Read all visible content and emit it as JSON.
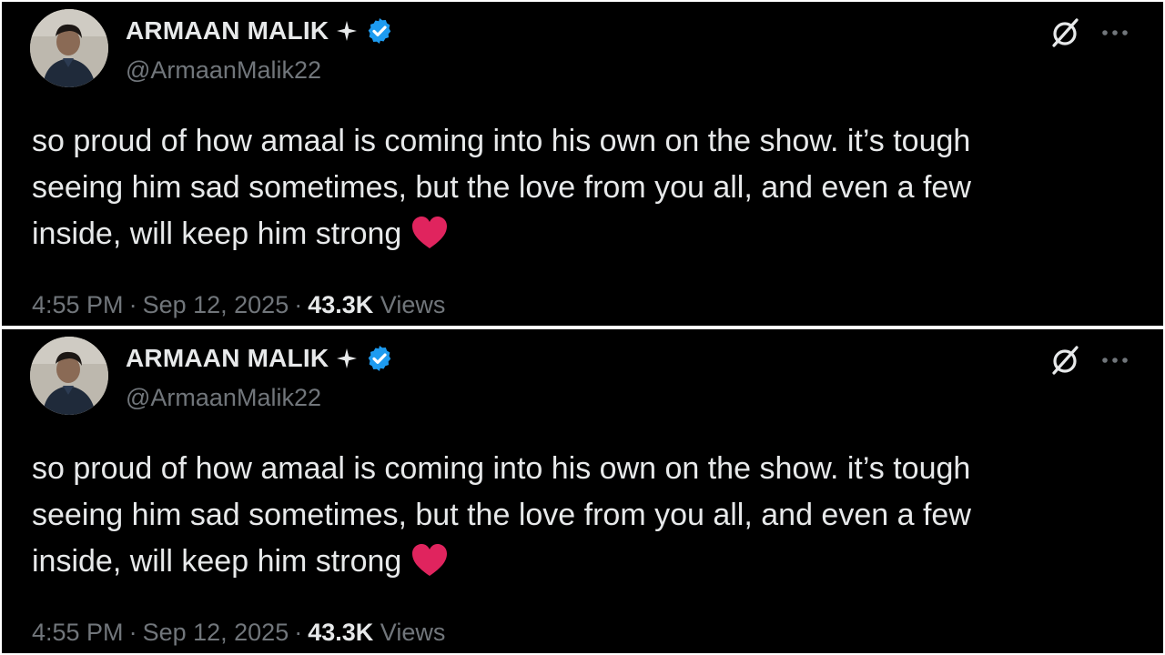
{
  "tweets": [
    {
      "author": {
        "display_name": "ARMAAN MALIK",
        "handle": "@ArmaanMalik22",
        "avatar_icon": "avatar-photo",
        "badges": [
          "sparkle-icon",
          "verified-icon"
        ],
        "verified_color": "#1d9bf0"
      },
      "text": {
        "line1": "so proud of how amaal is coming into his own on the show. it’s tough",
        "line2": "seeing him sad sometimes, but the love from you all, and even a few",
        "line3": "inside, will keep him strong",
        "emoji": "red-heart"
      },
      "meta": {
        "time": "4:55 PM",
        "separator": "·",
        "date": "Sep 12, 2025",
        "views_count": "43.3K",
        "views_label": "Views"
      },
      "actions": {
        "grok_icon": "grok-icon",
        "more_icon": "more-options-icon"
      }
    },
    {
      "author": {
        "display_name": "ARMAAN MALIK",
        "handle": "@ArmaanMalik22",
        "avatar_icon": "avatar-photo",
        "badges": [
          "sparkle-icon",
          "verified-icon"
        ],
        "verified_color": "#1d9bf0"
      },
      "text": {
        "line1": "so proud of how amaal is coming into his own on the show. it’s tough",
        "line2": "seeing him sad sometimes, but the love from you all, and even a few",
        "line3": "inside, will keep him strong",
        "emoji": "red-heart"
      },
      "meta": {
        "time": "4:55 PM",
        "separator": "·",
        "date": "Sep 12, 2025",
        "views_count": "43.3K",
        "views_label": "Views"
      },
      "actions": {
        "grok_icon": "grok-icon",
        "more_icon": "more-options-icon"
      }
    }
  ],
  "colors": {
    "background": "#000000",
    "text_primary": "#e7e9ea",
    "text_secondary": "#71767b",
    "heart": "#e0245e"
  }
}
